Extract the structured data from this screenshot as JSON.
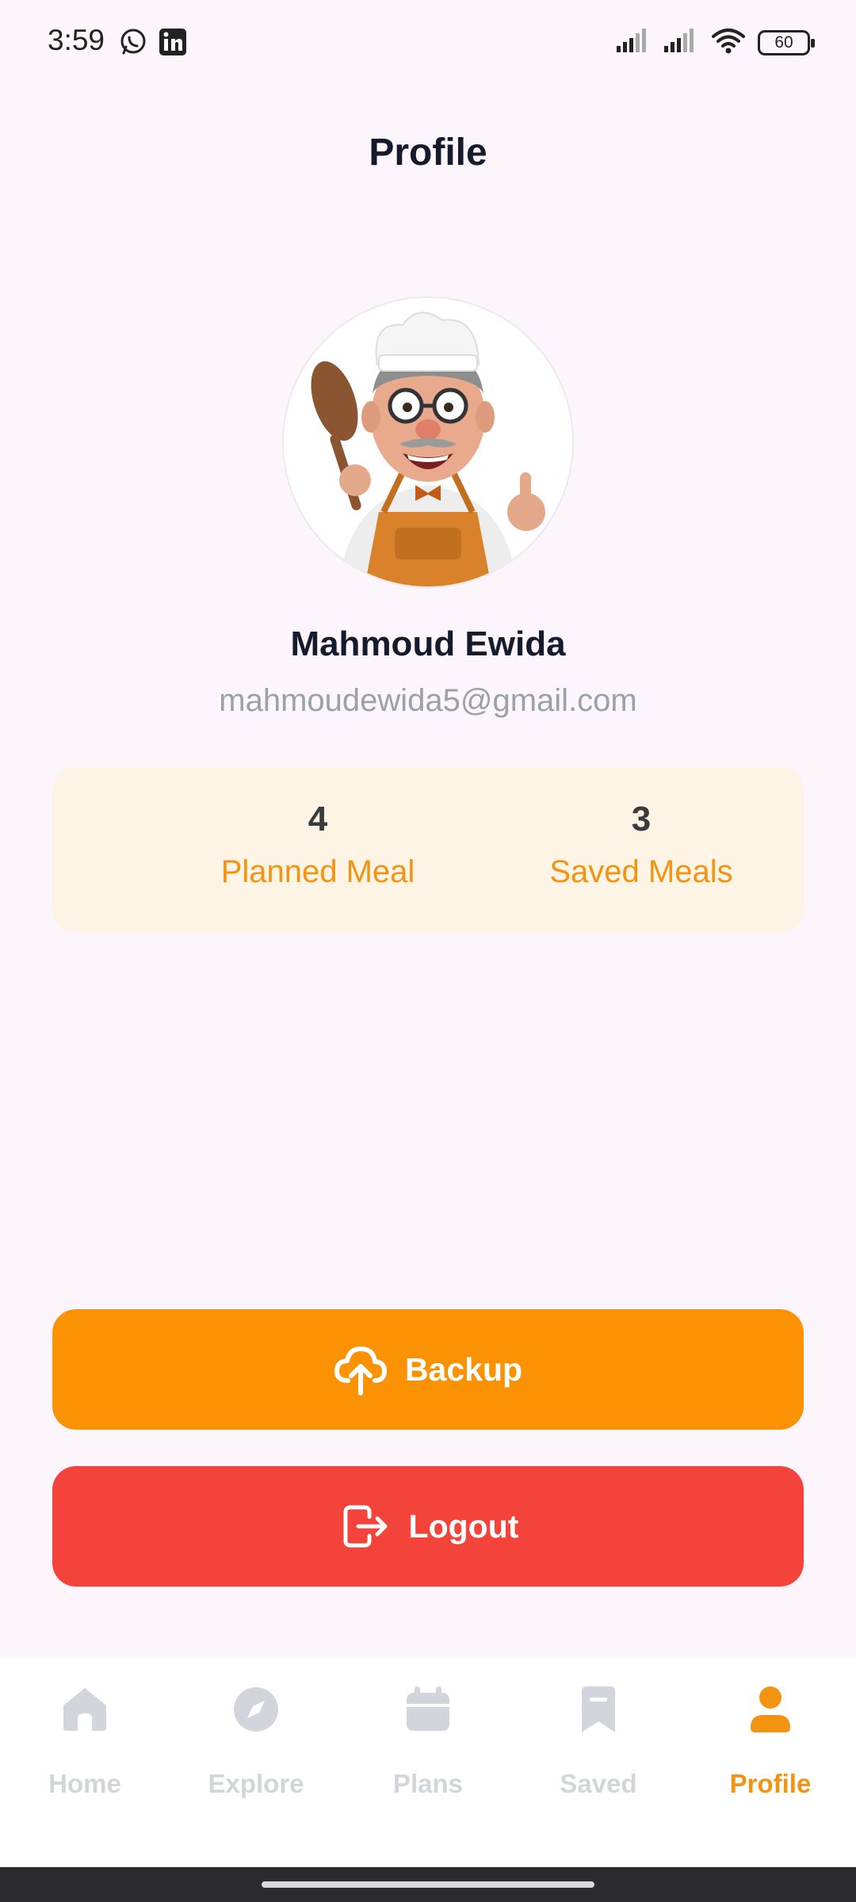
{
  "status_bar": {
    "time": "3:59",
    "battery": "60",
    "icons": [
      "whatsapp-icon",
      "linkedin-icon",
      "signal-icon",
      "signal-icon",
      "wifi-icon",
      "battery-icon"
    ]
  },
  "header": {
    "title": "Profile"
  },
  "profile": {
    "avatar": "chef-avatar-image",
    "name": "Mahmoud Ewida",
    "email": "mahmoudewida5@gmail.com"
  },
  "stats": [
    {
      "value": "4",
      "label": "Planned Meal"
    },
    {
      "value": "3",
      "label": "Saved Meals"
    }
  ],
  "actions": {
    "backup_label": "Backup",
    "logout_label": "Logout"
  },
  "nav": {
    "items": [
      {
        "label": "Home",
        "icon": "home-icon"
      },
      {
        "label": "Explore",
        "icon": "compass-icon"
      },
      {
        "label": "Plans",
        "icon": "calendar-icon"
      },
      {
        "label": "Saved",
        "icon": "bookmark-icon"
      },
      {
        "label": "Profile",
        "icon": "person-icon",
        "active": true
      }
    ]
  },
  "colors": {
    "accent": "#F39312",
    "backup_button": "#FB9204",
    "logout_button": "#F3433A",
    "background": "#FDF5FC",
    "stats_card": "#FEF4E5"
  }
}
